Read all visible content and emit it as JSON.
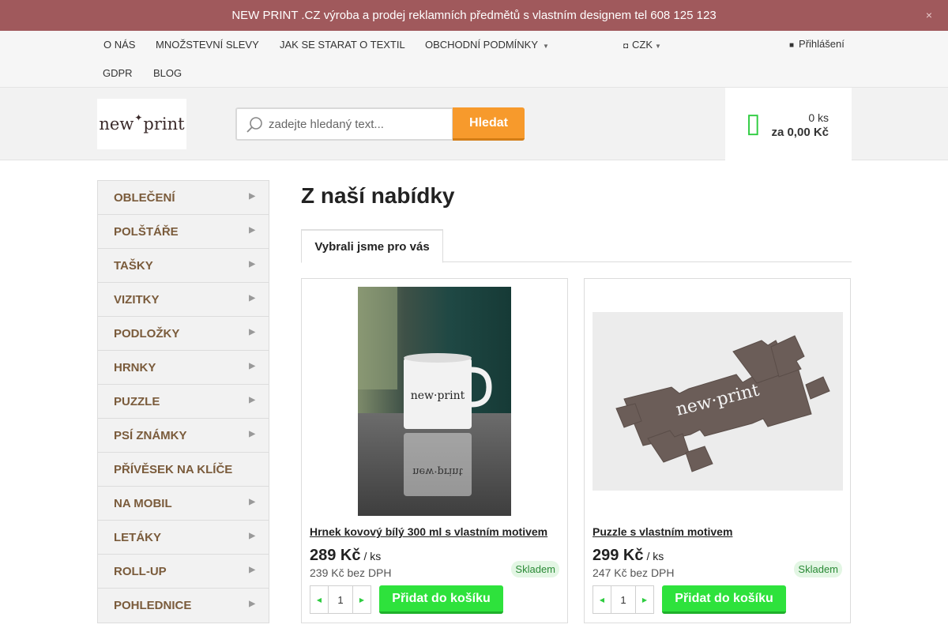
{
  "banner": {
    "text": "NEW PRINT .CZ výroba a prodej reklamních předmětů s vlastním designem tel 608 125 123",
    "close_glyph": "×"
  },
  "topnav": {
    "items": [
      "O NÁS",
      "MNOŽSTEVNÍ SLEVY",
      "JAK SE STARAT O TEXTIL",
      "OBCHODNÍ PODMÍNKY",
      "GDPR",
      "BLOG"
    ],
    "currency": "CZK",
    "login": "Přihlášení"
  },
  "header": {
    "logo_text_left": "new",
    "logo_text_right": "print",
    "search_placeholder": "zadejte hledaný text...",
    "search_button": "Hledat",
    "cart_count": "0 ks",
    "cart_total": "za 0,00 Kč"
  },
  "sidebar": {
    "items": [
      {
        "label": "OBLEČENÍ",
        "has_sub": true
      },
      {
        "label": "POLŠTÁŘE",
        "has_sub": true
      },
      {
        "label": "TAŠKY",
        "has_sub": true
      },
      {
        "label": "VIZITKY",
        "has_sub": true
      },
      {
        "label": "PODLOŽKY",
        "has_sub": true
      },
      {
        "label": "HRNKY",
        "has_sub": true
      },
      {
        "label": "PUZZLE",
        "has_sub": true
      },
      {
        "label": "PSÍ ZNÁMKY",
        "has_sub": true
      },
      {
        "label": "PŘÍVĚSEK NA KLÍČE",
        "has_sub": false
      },
      {
        "label": "NA MOBIL",
        "has_sub": true
      },
      {
        "label": "LETÁKY",
        "has_sub": true
      },
      {
        "label": "ROLL-UP",
        "has_sub": true
      },
      {
        "label": "POHLEDNICE",
        "has_sub": true
      }
    ]
  },
  "main": {
    "title": "Z naší nabídky",
    "tab": "Vybrali jsme pro vás",
    "products": [
      {
        "name": "Hrnek kovový bílý 300 ml s vlastním motivem",
        "price": "289 Kč",
        "unit": "/ ks",
        "price_net": "239 Kč bez DPH",
        "stock": "Skladem",
        "qty": "1",
        "add_label": "Přidat do košíku"
      },
      {
        "name": "Puzzle s vlastním motivem",
        "price": "299 Kč",
        "unit": "/ ks",
        "price_net": "247 Kč bez DPH",
        "stock": "Skladem",
        "qty": "1",
        "add_label": "Přidat do košíku"
      }
    ]
  },
  "colors": {
    "banner": "#a0595c",
    "accent_orange": "#f79a2c",
    "accent_green": "#2ee23c",
    "sidebar_text": "#7a5b3b"
  }
}
